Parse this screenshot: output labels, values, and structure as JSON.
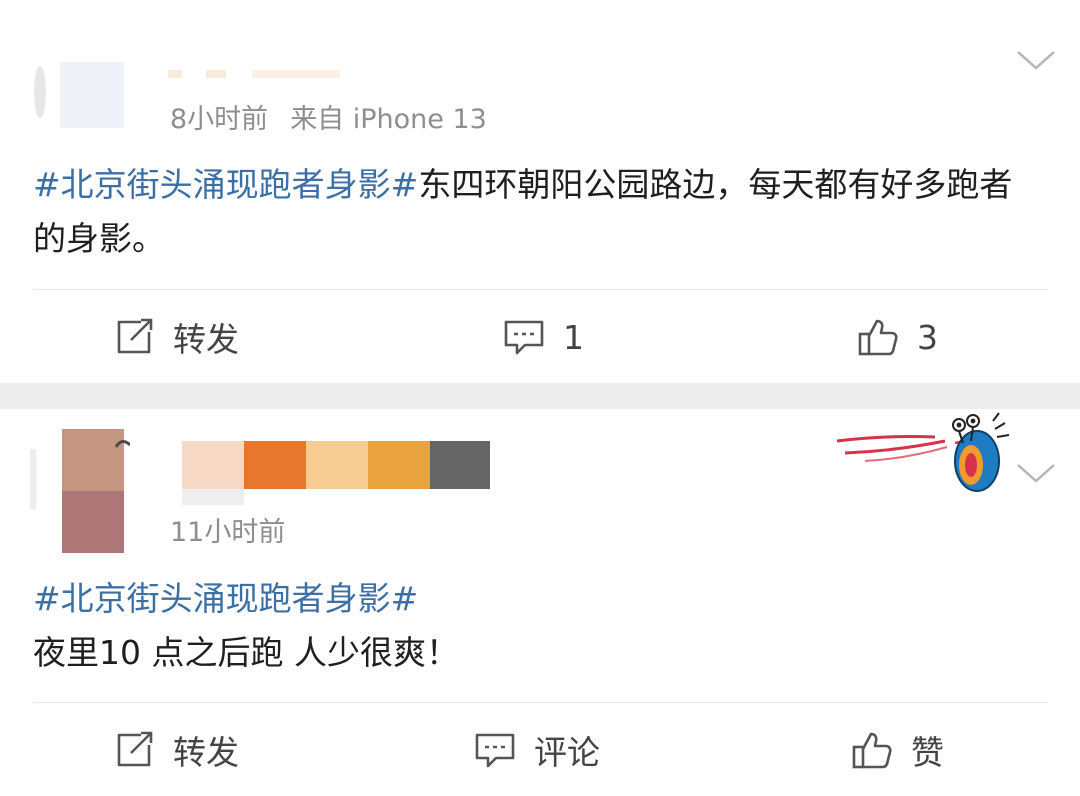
{
  "posts": [
    {
      "time": "8小时前",
      "source": "来自 iPhone 13",
      "topic": "#北京街头涌现跑者身影#",
      "text": "东四环朝阳公园路边，每天都有好多跑者的身影。",
      "actions": {
        "repost": "转发",
        "comment": "1",
        "like": "3"
      }
    },
    {
      "time": "11小时前",
      "topic": "#北京街头涌现跑者身影#",
      "text": "夜里10 点之后跑  人少很爽！",
      "actions": {
        "repost": "转发",
        "comment": "评论",
        "like": "赞"
      }
    }
  ],
  "icons": [
    "repost-icon",
    "comment-icon",
    "like-icon",
    "chevron-down-icon",
    "snail-sticker-icon"
  ],
  "colors": {
    "topic_link": "#3c6fa6",
    "meta_text": "#8e8e8e",
    "separator": "#ededed"
  }
}
